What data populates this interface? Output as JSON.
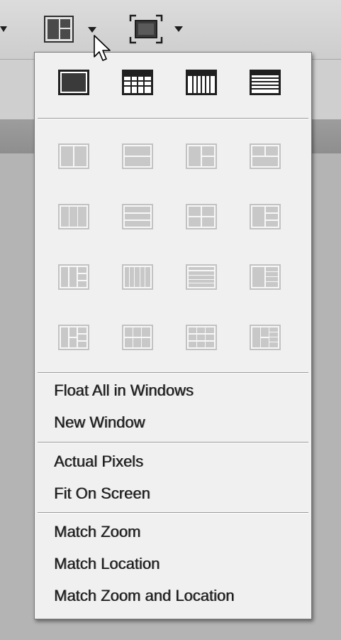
{
  "toolbar": {
    "arrange_button_icon": "arrange-documents-icon",
    "screen_mode_button_icon": "screen-mode-icon"
  },
  "menu": {
    "layout_rows": [
      [
        {
          "name": "consolidate-all-icon",
          "enabled": true
        },
        {
          "name": "tile-all-in-grid-icon",
          "enabled": true
        },
        {
          "name": "tile-all-vertically-icon",
          "enabled": true
        },
        {
          "name": "tile-all-horizontally-icon",
          "enabled": true
        }
      ],
      [
        {
          "name": "two-up-vertical-icon",
          "enabled": false
        },
        {
          "name": "two-up-horizontal-icon",
          "enabled": false
        },
        {
          "name": "three-up-stacked-icon",
          "enabled": false
        },
        {
          "name": "three-up-horizontal-icon",
          "enabled": false
        }
      ],
      [
        {
          "name": "three-up-vertical-icon",
          "enabled": false
        },
        {
          "name": "three-up-rows-icon",
          "enabled": false
        },
        {
          "name": "four-up-icon",
          "enabled": false
        },
        {
          "name": "four-up-stacked-icon",
          "enabled": false
        }
      ],
      [
        {
          "name": "five-up-icon",
          "enabled": false
        },
        {
          "name": "five-up-vertical-icon",
          "enabled": false
        },
        {
          "name": "five-up-horizontal-icon",
          "enabled": false
        },
        {
          "name": "five-up-stacked-icon",
          "enabled": false
        }
      ],
      [
        {
          "name": "six-up-icon",
          "enabled": false
        },
        {
          "name": "six-up-grid-icon",
          "enabled": false
        },
        {
          "name": "six-up-rows-icon",
          "enabled": false
        },
        {
          "name": "six-up-stacked-icon",
          "enabled": false
        }
      ]
    ],
    "items": {
      "float_all": "Float All in Windows",
      "new_window": "New Window",
      "actual_pixels": "Actual Pixels",
      "fit_on_screen": "Fit On Screen",
      "match_zoom": "Match Zoom",
      "match_location": "Match Location",
      "match_zoom_location": "Match Zoom and Location"
    }
  }
}
